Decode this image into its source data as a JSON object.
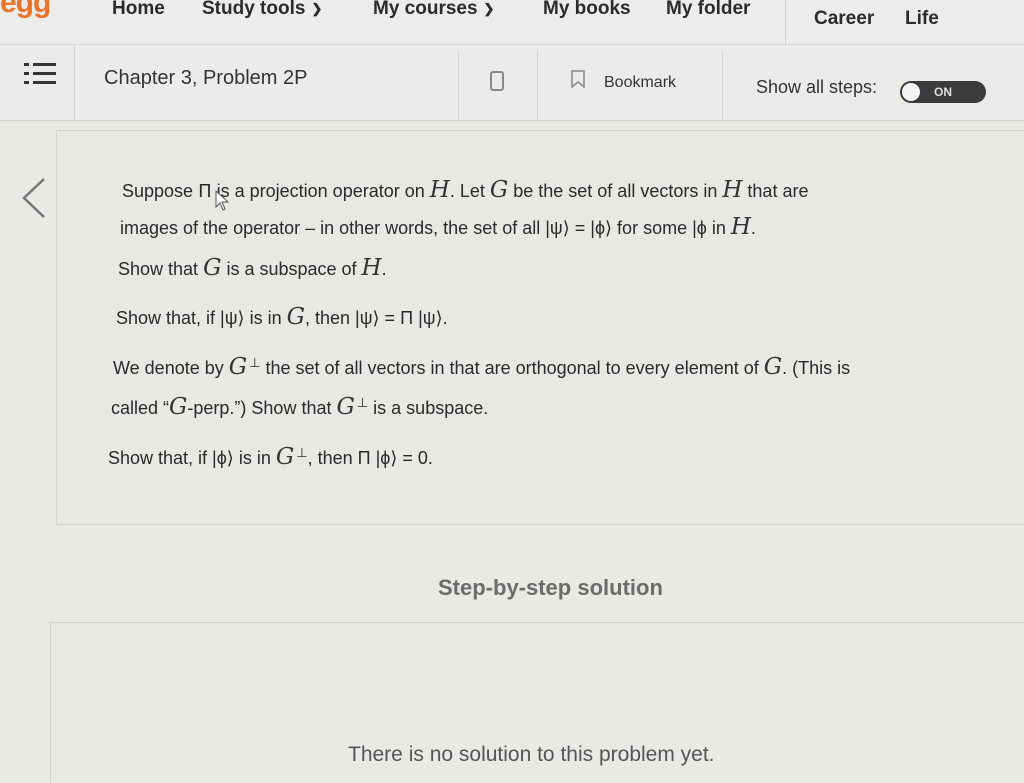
{
  "nav": {
    "logo": "egg",
    "items": [
      "Home",
      "Study tools",
      "My courses",
      "My books",
      "My folder",
      "Career",
      "Life"
    ]
  },
  "header": {
    "chapter_title": "Chapter 3, Problem 2P",
    "bookmark_label": "Bookmark",
    "show_steps_label": "Show all steps:",
    "toggle_state": "ON"
  },
  "problem": {
    "l1a": "Suppose ",
    "l1b": "is a projection operator on ",
    "l1c": ". Let ",
    "l1d": " be the set of all vectors in ",
    "l1e": " that are",
    "l2a": "images of the operator – in other words, the set of all |ψ⟩ = |ϕ⟩ for some |ϕ in ",
    "l3a": "Show that ",
    "l3b": " is a subspace of ",
    "l4a": "Show that, if |ψ⟩ is in ",
    "l4b": ", then |ψ⟩ = Π |ψ⟩.",
    "l5a": "We denote by ",
    "l5b": " the set of all vectors in that are orthogonal to every element of ",
    "l5c": ". (This is",
    "l6a": "called “",
    "l6b": "-perp.”) Show that ",
    "l6c": " is a subspace.",
    "l7a": "Show that, if |ϕ⟩ is in ",
    "l7b": ", then Π |ϕ⟩ = 0.",
    "pi_symbol": "Π",
    "h_symbol": "H",
    "g_symbol": "G",
    "perp": "⊥"
  },
  "solution": {
    "title": "Step-by-step solution",
    "empty_text": "There is no solution to this problem yet."
  },
  "colors": {
    "logo": "#e8732a",
    "toggle_bg": "#3b3b3d"
  }
}
